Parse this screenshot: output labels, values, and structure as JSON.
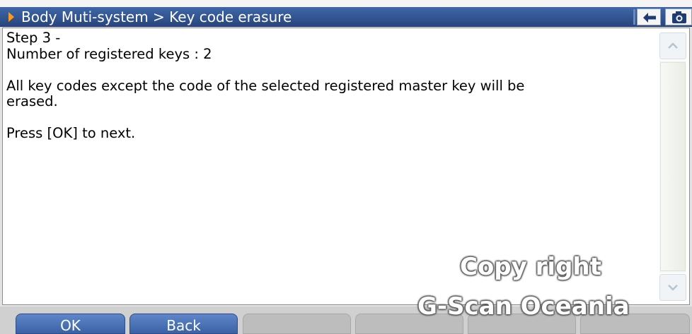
{
  "header": {
    "breadcrumb": "Body Muti-system > Key code erasure",
    "back_icon": "back-arrow-icon",
    "camera_icon": "camera-icon"
  },
  "content": {
    "lines": [
      "Step 3 -",
      "Number of registered keys : 2",
      "",
      "All key codes except the code of the selected registered master key will be",
      "erased.",
      "",
      "Press [OK] to next."
    ]
  },
  "footer": {
    "ok_label": "OK",
    "back_label": "Back"
  },
  "watermark": {
    "line1": "Copy right",
    "line2": "G-Scan Oceania"
  },
  "colors": {
    "title_bar": "#29467f",
    "arrow": "#f49b22",
    "active_button": "#3b62a6"
  }
}
